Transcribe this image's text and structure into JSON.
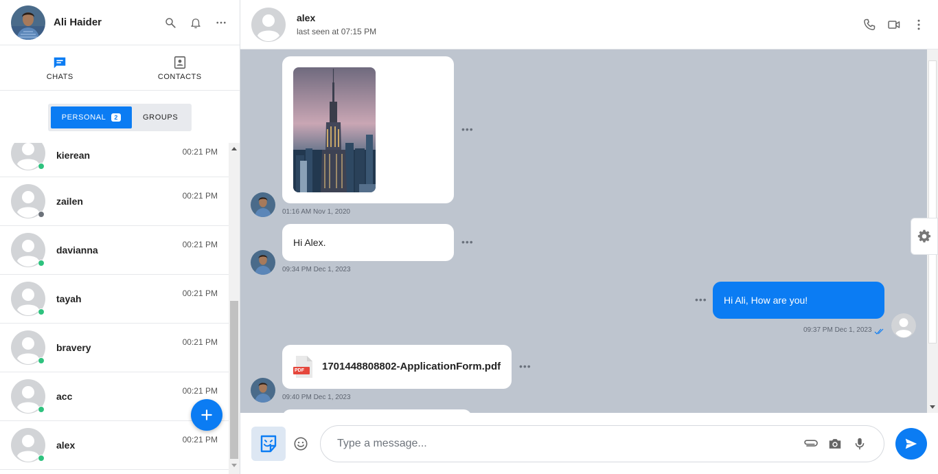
{
  "user": {
    "name": "Ali Haider"
  },
  "tabs": [
    {
      "label": "CHATS",
      "icon": "chat-icon",
      "active": true
    },
    {
      "label": "CONTACTS",
      "icon": "contacts-icon",
      "active": false
    }
  ],
  "segment": {
    "personal_label": "PERSONAL",
    "personal_badge": "2",
    "groups_label": "GROUPS"
  },
  "chat_list": [
    {
      "name": "kierean",
      "time": "00:21 PM",
      "status": "online"
    },
    {
      "name": "zailen",
      "time": "00:21 PM",
      "status": "offline"
    },
    {
      "name": "davianna",
      "time": "00:21 PM",
      "status": "online"
    },
    {
      "name": "tayah",
      "time": "00:21 PM",
      "status": "online"
    },
    {
      "name": "bravery",
      "time": "00:21 PM",
      "status": "online"
    },
    {
      "name": "acc",
      "time": "00:21 PM",
      "status": "online"
    },
    {
      "name": "alex",
      "time": "00:21 PM",
      "status": "online"
    }
  ],
  "conversation": {
    "name": "alex",
    "status": "last seen at 07:15 PM",
    "messages": [
      {
        "type": "image",
        "direction": "in",
        "time": "01:16 AM Nov 1, 2020"
      },
      {
        "type": "text",
        "direction": "in",
        "text": "Hi Alex.",
        "time": "09:34 PM Dec 1, 2023"
      },
      {
        "type": "text",
        "direction": "out",
        "text": "Hi Ali, How are you!",
        "time": "09:37 PM Dec 1, 2023"
      },
      {
        "type": "file",
        "direction": "in",
        "file_name": "1701448808802-ApplicationForm.pdf",
        "file_badge": "PDF",
        "time": "09:40 PM Dec 1, 2023"
      }
    ]
  },
  "composer": {
    "placeholder": "Type a message..."
  },
  "colors": {
    "accent": "#0b7cf3",
    "chat_bg": "#bec5cf",
    "online": "#2ec27e",
    "offline": "#6c727a"
  }
}
